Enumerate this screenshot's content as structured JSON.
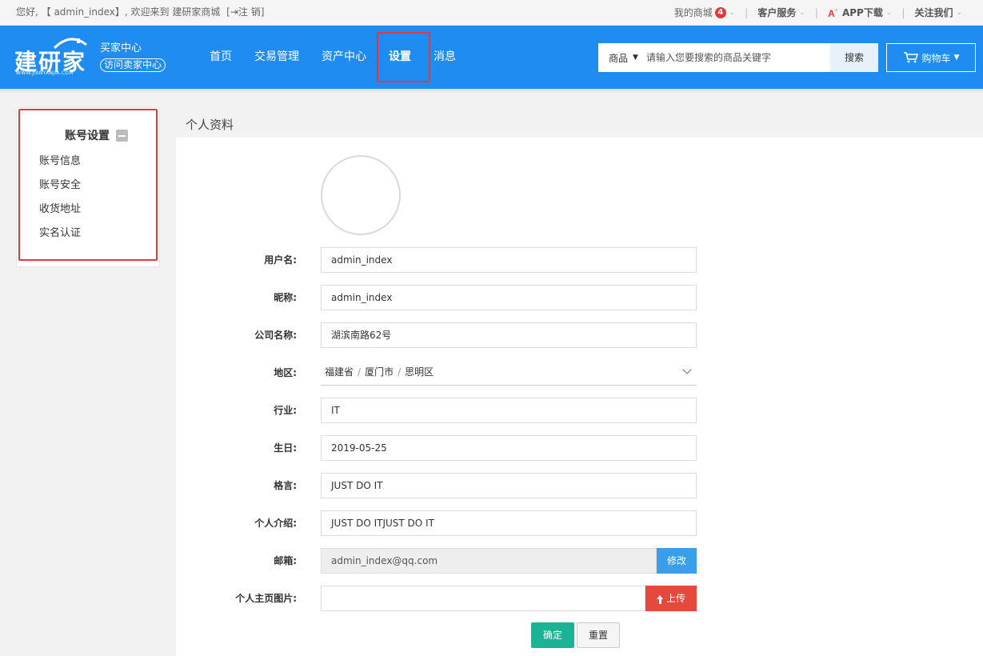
{
  "topbar": {
    "welcome": "您好, 【 admin_index】, 欢迎来到 建研家商城",
    "logout_icon": "sign-out-icon",
    "logout": "[⇥注 销]",
    "my_mall": "我的商城",
    "my_mall_badge": "4",
    "customer_service": "客户服务",
    "app_download": "APP下载",
    "follow_us": "关注我们"
  },
  "header": {
    "logo_text": "建研家",
    "logo_sub": "WWW.JIANYANJIA.COM",
    "buyer_center": "买家中心",
    "visit_seller": "访问卖家中心",
    "nav": [
      {
        "label": "首页"
      },
      {
        "label": "交易管理"
      },
      {
        "label": "资产中心"
      },
      {
        "label": "设置"
      },
      {
        "label": "消息"
      }
    ],
    "search": {
      "category": "商品",
      "placeholder": "请输入您要搜索的商品关键字",
      "button": "搜索"
    },
    "cart": "购物车"
  },
  "sidebar": {
    "title": "账号设置",
    "items": [
      {
        "label": "账号信息"
      },
      {
        "label": "账号安全"
      },
      {
        "label": "收货地址"
      },
      {
        "label": "实名认证"
      }
    ]
  },
  "main": {
    "title": "个人资料",
    "form": {
      "username_label": "用户名:",
      "username": "admin_index",
      "nickname_label": "昵称:",
      "nickname": "admin_index",
      "company_label": "公司名称:",
      "company": "湖滨南路62号",
      "region_label": "地区:",
      "region": [
        "福建省",
        "厦门市",
        "思明区"
      ],
      "industry_label": "行业:",
      "industry": "IT",
      "birthday_label": "生日:",
      "birthday": "2019-05-25",
      "motto_label": "格言:",
      "motto": "JUST DO IT",
      "intro_label": "个人介绍:",
      "intro": "JUST DO ITJUST DO IT",
      "email_label": "邮箱:",
      "email": "admin_index@qq.com",
      "modify": "修改",
      "homepage_label": "个人主页图片:",
      "upload": "上传",
      "confirm": "确定",
      "reset": "重置"
    }
  },
  "colors": {
    "header_bg": "#1e8cf0",
    "highlight": "#e4393c",
    "confirm": "#1ab394",
    "upload": "#e4493c",
    "modify": "#3a9ee8"
  }
}
